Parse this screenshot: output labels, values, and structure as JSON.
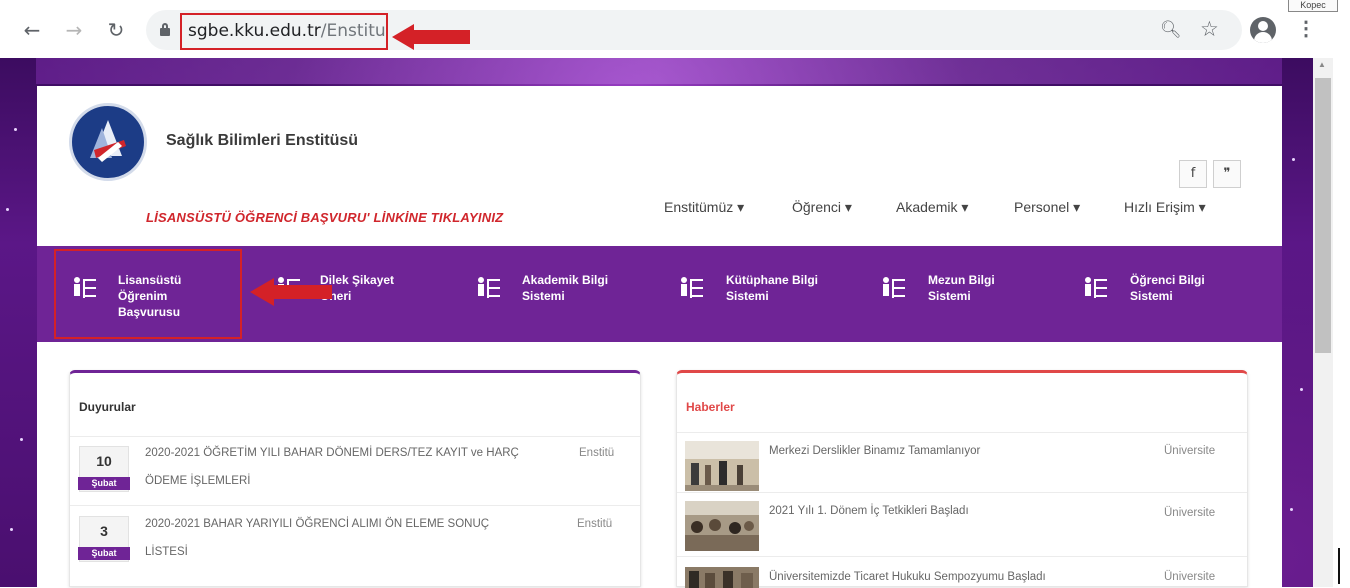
{
  "browser": {
    "url_host": "sgbe.kku.edu.tr",
    "url_path": "/Enstitu",
    "corner_label": "Kopec"
  },
  "site": {
    "title": "Sağlık Bilimleri Enstitüsü",
    "promo": "LİSANSÜSTÜ ÖĞRENCİ BAŞVURU' LİNKİNE TIKLAYINIZ",
    "social": {
      "facebook": "f",
      "twitter": "❞"
    },
    "menu": [
      {
        "label": "Enstitümüz ▾"
      },
      {
        "label": "Öğrenci ▾"
      },
      {
        "label": "Akademik ▾"
      },
      {
        "label": "Personel ▾"
      },
      {
        "label": "Hızlı Erişim ▾"
      }
    ]
  },
  "quicklinks": [
    {
      "line1": "Lisansüstü",
      "line2": "Öğrenim",
      "line3": "Başvurusu"
    },
    {
      "line1": "Dilek Şikayet",
      "line2": "Öneri",
      "line3": ""
    },
    {
      "line1": "Akademik Bilgi",
      "line2": "Sistemi",
      "line3": ""
    },
    {
      "line1": "Kütüphane Bilgi",
      "line2": "Sistemi",
      "line3": ""
    },
    {
      "line1": "Mezun Bilgi",
      "line2": "Sistemi",
      "line3": ""
    },
    {
      "line1": "Öğrenci Bilgi",
      "line2": "Sistemi",
      "line3": ""
    }
  ],
  "announcements": {
    "title": "Duyurular",
    "items": [
      {
        "day": "10",
        "month": "Şubat",
        "line1": "2020-2021 ÖĞRETİM YILI BAHAR DÖNEMİ DERS/TEZ KAYIT ve HARÇ",
        "line2": "ÖDEME İŞLEMLERİ",
        "tag": "Enstitü"
      },
      {
        "day": "3",
        "month": "Şubat",
        "line1": "2020-2021 BAHAR YARIYILI ÖĞRENCİ ALIMI ÖN ELEME SONUÇ",
        "line2": "LİSTESİ",
        "tag": "Enstitü"
      }
    ]
  },
  "news": {
    "title": "Haberler",
    "items": [
      {
        "title": "Merkezi Derslikler Binamız Tamamlanıyor",
        "tag": "Üniversite"
      },
      {
        "title": "2021 Yılı 1. Dönem İç Tetkikleri Başladı",
        "tag": "Üniversite"
      },
      {
        "title": "Üniversitemizde Ticaret Hukuku Sempozyumu Başladı",
        "tag": "Üniversite"
      }
    ]
  },
  "colors": {
    "brand_purple": "#6f2496",
    "annotation_red": "#d42127",
    "news_accent": "#e04848"
  }
}
